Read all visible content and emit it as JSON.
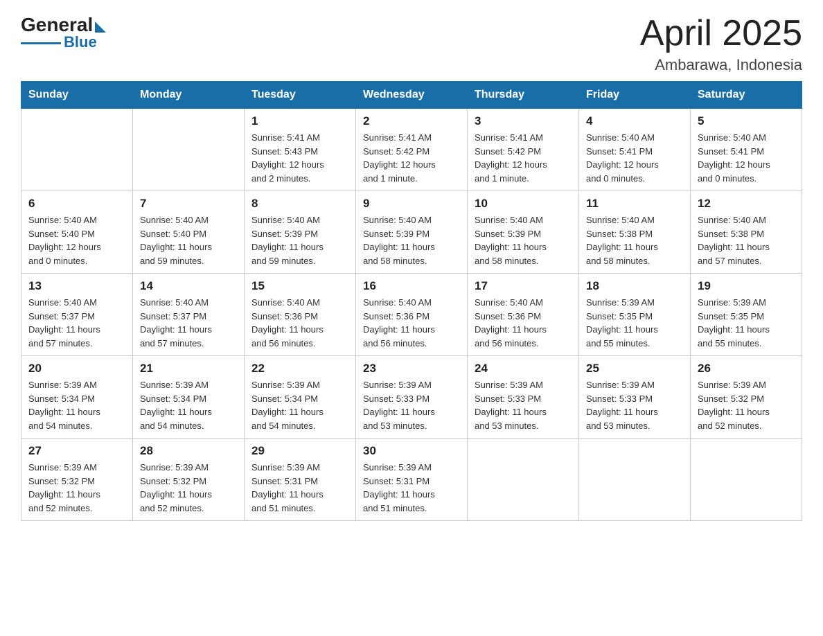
{
  "logo": {
    "general": "General",
    "blue": "Blue"
  },
  "title": "April 2025",
  "location": "Ambarawa, Indonesia",
  "days_of_week": [
    "Sunday",
    "Monday",
    "Tuesday",
    "Wednesday",
    "Thursday",
    "Friday",
    "Saturday"
  ],
  "weeks": [
    [
      {
        "day": "",
        "info": ""
      },
      {
        "day": "",
        "info": ""
      },
      {
        "day": "1",
        "info": "Sunrise: 5:41 AM\nSunset: 5:43 PM\nDaylight: 12 hours\nand 2 minutes."
      },
      {
        "day": "2",
        "info": "Sunrise: 5:41 AM\nSunset: 5:42 PM\nDaylight: 12 hours\nand 1 minute."
      },
      {
        "day": "3",
        "info": "Sunrise: 5:41 AM\nSunset: 5:42 PM\nDaylight: 12 hours\nand 1 minute."
      },
      {
        "day": "4",
        "info": "Sunrise: 5:40 AM\nSunset: 5:41 PM\nDaylight: 12 hours\nand 0 minutes."
      },
      {
        "day": "5",
        "info": "Sunrise: 5:40 AM\nSunset: 5:41 PM\nDaylight: 12 hours\nand 0 minutes."
      }
    ],
    [
      {
        "day": "6",
        "info": "Sunrise: 5:40 AM\nSunset: 5:40 PM\nDaylight: 12 hours\nand 0 minutes."
      },
      {
        "day": "7",
        "info": "Sunrise: 5:40 AM\nSunset: 5:40 PM\nDaylight: 11 hours\nand 59 minutes."
      },
      {
        "day": "8",
        "info": "Sunrise: 5:40 AM\nSunset: 5:39 PM\nDaylight: 11 hours\nand 59 minutes."
      },
      {
        "day": "9",
        "info": "Sunrise: 5:40 AM\nSunset: 5:39 PM\nDaylight: 11 hours\nand 58 minutes."
      },
      {
        "day": "10",
        "info": "Sunrise: 5:40 AM\nSunset: 5:39 PM\nDaylight: 11 hours\nand 58 minutes."
      },
      {
        "day": "11",
        "info": "Sunrise: 5:40 AM\nSunset: 5:38 PM\nDaylight: 11 hours\nand 58 minutes."
      },
      {
        "day": "12",
        "info": "Sunrise: 5:40 AM\nSunset: 5:38 PM\nDaylight: 11 hours\nand 57 minutes."
      }
    ],
    [
      {
        "day": "13",
        "info": "Sunrise: 5:40 AM\nSunset: 5:37 PM\nDaylight: 11 hours\nand 57 minutes."
      },
      {
        "day": "14",
        "info": "Sunrise: 5:40 AM\nSunset: 5:37 PM\nDaylight: 11 hours\nand 57 minutes."
      },
      {
        "day": "15",
        "info": "Sunrise: 5:40 AM\nSunset: 5:36 PM\nDaylight: 11 hours\nand 56 minutes."
      },
      {
        "day": "16",
        "info": "Sunrise: 5:40 AM\nSunset: 5:36 PM\nDaylight: 11 hours\nand 56 minutes."
      },
      {
        "day": "17",
        "info": "Sunrise: 5:40 AM\nSunset: 5:36 PM\nDaylight: 11 hours\nand 56 minutes."
      },
      {
        "day": "18",
        "info": "Sunrise: 5:39 AM\nSunset: 5:35 PM\nDaylight: 11 hours\nand 55 minutes."
      },
      {
        "day": "19",
        "info": "Sunrise: 5:39 AM\nSunset: 5:35 PM\nDaylight: 11 hours\nand 55 minutes."
      }
    ],
    [
      {
        "day": "20",
        "info": "Sunrise: 5:39 AM\nSunset: 5:34 PM\nDaylight: 11 hours\nand 54 minutes."
      },
      {
        "day": "21",
        "info": "Sunrise: 5:39 AM\nSunset: 5:34 PM\nDaylight: 11 hours\nand 54 minutes."
      },
      {
        "day": "22",
        "info": "Sunrise: 5:39 AM\nSunset: 5:34 PM\nDaylight: 11 hours\nand 54 minutes."
      },
      {
        "day": "23",
        "info": "Sunrise: 5:39 AM\nSunset: 5:33 PM\nDaylight: 11 hours\nand 53 minutes."
      },
      {
        "day": "24",
        "info": "Sunrise: 5:39 AM\nSunset: 5:33 PM\nDaylight: 11 hours\nand 53 minutes."
      },
      {
        "day": "25",
        "info": "Sunrise: 5:39 AM\nSunset: 5:33 PM\nDaylight: 11 hours\nand 53 minutes."
      },
      {
        "day": "26",
        "info": "Sunrise: 5:39 AM\nSunset: 5:32 PM\nDaylight: 11 hours\nand 52 minutes."
      }
    ],
    [
      {
        "day": "27",
        "info": "Sunrise: 5:39 AM\nSunset: 5:32 PM\nDaylight: 11 hours\nand 52 minutes."
      },
      {
        "day": "28",
        "info": "Sunrise: 5:39 AM\nSunset: 5:32 PM\nDaylight: 11 hours\nand 52 minutes."
      },
      {
        "day": "29",
        "info": "Sunrise: 5:39 AM\nSunset: 5:31 PM\nDaylight: 11 hours\nand 51 minutes."
      },
      {
        "day": "30",
        "info": "Sunrise: 5:39 AM\nSunset: 5:31 PM\nDaylight: 11 hours\nand 51 minutes."
      },
      {
        "day": "",
        "info": ""
      },
      {
        "day": "",
        "info": ""
      },
      {
        "day": "",
        "info": ""
      }
    ]
  ]
}
